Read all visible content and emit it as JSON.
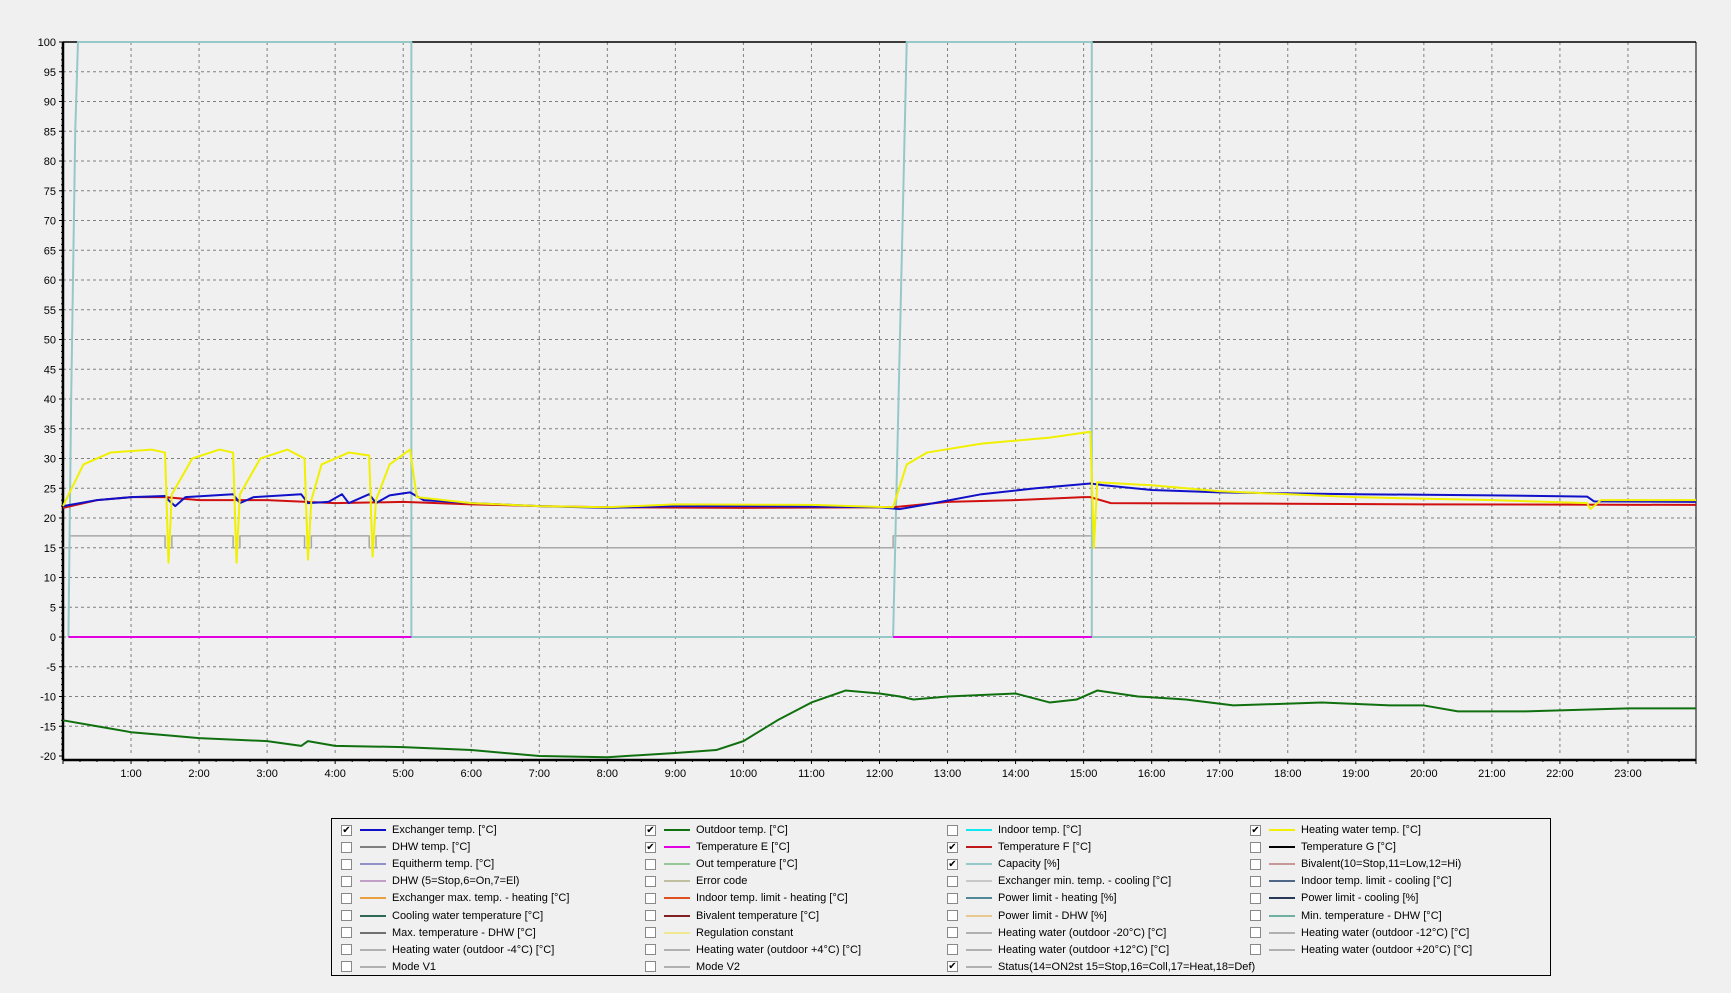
{
  "chart_data": {
    "type": "line",
    "title": "",
    "xlabel": "",
    "ylabel": "",
    "xlim": [
      0,
      24
    ],
    "ylim": [
      -20,
      100
    ],
    "grid": true,
    "x_tick_labels": [
      "1:00",
      "2:00",
      "3:00",
      "4:00",
      "5:00",
      "6:00",
      "7:00",
      "8:00",
      "9:00",
      "10:00",
      "11:00",
      "12:00",
      "13:00",
      "14:00",
      "15:00",
      "16:00",
      "17:00",
      "18:00",
      "19:00",
      "20:00",
      "21:00",
      "22:00",
      "23:00"
    ],
    "y_tick_labels": [
      "100",
      "95",
      "90",
      "85",
      "80",
      "75",
      "70",
      "65",
      "60",
      "55",
      "50",
      "45",
      "40",
      "35",
      "30",
      "25",
      "20",
      "15",
      "10",
      "5",
      "0",
      "-5",
      "-10",
      "-15",
      "-20"
    ],
    "legend_placement": "bottom",
    "series": [
      {
        "name": "Status",
        "color": "#a8a8a8",
        "x": [
          0,
          0.1,
          0.1,
          1.5,
          1.5,
          1.6,
          1.6,
          2.5,
          2.5,
          2.6,
          2.6,
          3.55,
          3.55,
          3.65,
          3.65,
          4.5,
          4.5,
          4.6,
          4.6,
          5.12,
          5.12,
          12.2,
          12.2,
          15.12,
          15.12,
          24
        ],
        "y": [
          15,
          15,
          17,
          17,
          15,
          15,
          17,
          17,
          15,
          15,
          17,
          17,
          15,
          15,
          17,
          17,
          15,
          15,
          17,
          17,
          15,
          15,
          17,
          17,
          15,
          15
        ]
      },
      {
        "name": "Capacity",
        "color": "#96c8c8",
        "x": [
          0.08,
          0.12,
          0.18,
          0.22,
          5.12,
          5.12,
          12.2,
          12.4,
          15.12,
          15.12,
          24
        ],
        "y": [
          0,
          40,
          85,
          100,
          100,
          0,
          0,
          100,
          100,
          0,
          0
        ]
      },
      {
        "name": "Temperature E",
        "color": "#e000e0",
        "x": [
          0.08,
          5.12
        ],
        "y": [
          0,
          0
        ],
        "x2": [
          12.2,
          15.12
        ]
      },
      {
        "name": "Outdoor temp.",
        "color": "#107010",
        "x": [
          0,
          0.5,
          1,
          1.5,
          2,
          3,
          3.5,
          3.6,
          4,
          5,
          6,
          7,
          8,
          9,
          9.6,
          10,
          10.5,
          11,
          11.5,
          12,
          12.3,
          12.5,
          13,
          14,
          14.5,
          14.9,
          15.2,
          15.8,
          16.5,
          17.2,
          18.5,
          19.5,
          20,
          20.5,
          21.5,
          23,
          24
        ],
        "y": [
          -14,
          -15,
          -16,
          -16.5,
          -17,
          -17.5,
          -18.3,
          -17.5,
          -18.3,
          -18.5,
          -19,
          -20,
          -20.2,
          -19.5,
          -19,
          -17.5,
          -14,
          -11,
          -9,
          -9.5,
          -10,
          -10.5,
          -10,
          -9.5,
          -11,
          -10.5,
          -9,
          -10,
          -10.5,
          -11.5,
          -11,
          -11.5,
          -11.5,
          -12.5,
          -12.5,
          -12,
          -12
        ]
      },
      {
        "name": "Temperature F",
        "color": "#d01010",
        "x": [
          0,
          0.5,
          1,
          1.5,
          2,
          3,
          4,
          5,
          6,
          7,
          8,
          10,
          12.2,
          13,
          14,
          15,
          15.1,
          15.4,
          18,
          20,
          24
        ],
        "y": [
          21.7,
          23,
          23.5,
          23.5,
          23,
          23,
          22.5,
          22.7,
          22.3,
          22,
          21.8,
          21.7,
          21.8,
          22.7,
          23,
          23.5,
          23.5,
          22.5,
          22.4,
          22.3,
          22.2
        ]
      },
      {
        "name": "Exchanger temp.",
        "color": "#1010c8",
        "x": [
          0,
          0.5,
          1,
          1.5,
          1.55,
          1.65,
          1.8,
          2.5,
          2.6,
          2.8,
          3.5,
          3.6,
          3.9,
          4.1,
          4.2,
          4.5,
          4.6,
          4.8,
          5.1,
          5.3,
          6,
          7,
          8,
          9,
          10,
          12,
          12.3,
          12.8,
          13.5,
          14.3,
          15.1,
          15.3,
          16,
          17,
          19,
          21,
          22.4,
          22.5,
          24
        ],
        "y": [
          22,
          23,
          23.5,
          23.7,
          23,
          22,
          23.5,
          24,
          22.5,
          23.5,
          24,
          22.5,
          22.7,
          24,
          22.5,
          24,
          22.5,
          23.8,
          24.3,
          23,
          22.5,
          22,
          21.7,
          22,
          22,
          21.8,
          21.5,
          22.5,
          24,
          25,
          25.8,
          25.5,
          24.7,
          24.3,
          24,
          23.8,
          23.6,
          22.8,
          22.7
        ]
      },
      {
        "name": "Heating water temp.",
        "color": "#f0f000",
        "x": [
          0,
          0.3,
          0.7,
          1.3,
          1.5,
          1.55,
          1.6,
          1.9,
          2.3,
          2.5,
          2.55,
          2.6,
          2.9,
          3.3,
          3.55,
          3.6,
          3.65,
          3.8,
          4.2,
          4.5,
          4.55,
          4.6,
          4.8,
          5.1,
          5.2,
          6,
          7,
          8,
          9,
          11,
          12.2,
          12.4,
          12.7,
          13.5,
          14.5,
          15.1,
          15.15,
          15.2,
          16,
          17,
          19,
          21,
          22.4,
          22.45,
          22.6,
          24
        ],
        "y": [
          22,
          29,
          31,
          31.5,
          31,
          12.5,
          24,
          30,
          31.5,
          31,
          12.5,
          24,
          30,
          31.5,
          30,
          13,
          23,
          29,
          31,
          30.5,
          13.5,
          23,
          29,
          31.5,
          23.5,
          22.5,
          22,
          21.8,
          22.3,
          22.2,
          21.8,
          29,
          31,
          32.5,
          33.5,
          34.5,
          15,
          26,
          25.5,
          24.5,
          23.5,
          23,
          22.5,
          21.5,
          23,
          23
        ]
      }
    ]
  },
  "legend": {
    "items": [
      {
        "label": "Exchanger temp. [°C]",
        "color": "#1010c8",
        "checked": true
      },
      {
        "label": "DHW temp. [°C]",
        "color": "#808080",
        "checked": false
      },
      {
        "label": "Equitherm temp. [°C]",
        "color": "#9090c8",
        "checked": false
      },
      {
        "label": "DHW (5=Stop,6=On,7=El)",
        "color": "#c0a0c8",
        "checked": false
      },
      {
        "label": "Exchanger max. temp. - heating [°C]",
        "color": "#e8a040",
        "checked": false
      },
      {
        "label": "Cooling water temperature [°C]",
        "color": "#306858",
        "checked": false
      },
      {
        "label": "Max. temperature - DHW [°C]",
        "color": "#707070",
        "checked": false
      },
      {
        "label": "Heating water (outdoor -4°C) [°C]",
        "color": "#b0b0b0",
        "checked": false
      },
      {
        "label": "Mode V1",
        "color": "#b0b0b0",
        "checked": false
      },
      {
        "label": "Outdoor temp. [°C]",
        "color": "#107010",
        "checked": true
      },
      {
        "label": "Temperature E [°C]",
        "color": "#e000e0",
        "checked": true
      },
      {
        "label": "Out temperature [°C]",
        "color": "#98c898",
        "checked": false
      },
      {
        "label": "Error code",
        "color": "#c0c0a0",
        "checked": false
      },
      {
        "label": "Indoor temp. limit - heating [°C]",
        "color": "#e05020",
        "checked": false
      },
      {
        "label": "Bivalent temperature [°C]",
        "color": "#802020",
        "checked": false
      },
      {
        "label": "Regulation constant",
        "color": "#f0e890",
        "checked": false
      },
      {
        "label": "Heating water (outdoor +4°C) [°C]",
        "color": "#b0b0b0",
        "checked": false
      },
      {
        "label": "Mode V2",
        "color": "#b0b0b0",
        "checked": false
      },
      {
        "label": "Indoor temp. [°C]",
        "color": "#10e8f0",
        "checked": false
      },
      {
        "label": "Temperature F [°C]",
        "color": "#c01818",
        "checked": true
      },
      {
        "label": "Capacity [%]",
        "color": "#96c8c8",
        "checked": true
      },
      {
        "label": "Exchanger min. temp. - cooling [°C]",
        "color": "#c8c8c8",
        "checked": false
      },
      {
        "label": "Power limit - heating [%]",
        "color": "#508898",
        "checked": false
      },
      {
        "label": "Power limit - DHW [%]",
        "color": "#e8c890",
        "checked": false
      },
      {
        "label": "Heating water (outdoor -20°C) [°C]",
        "color": "#b0b0b0",
        "checked": false
      },
      {
        "label": "Heating water (outdoor +12°C) [°C]",
        "color": "#b0b0b0",
        "checked": false
      },
      {
        "label": "Status(14=ON2st 15=Stop,16=Coll,17=Heat,18=Def)",
        "color": "#b0b0b0",
        "checked": true
      },
      {
        "label": "Heating water temp. [°C]",
        "color": "#f0f000",
        "checked": true
      },
      {
        "label": "Temperature G [°C]",
        "color": "#000000",
        "checked": false
      },
      {
        "label": "Bivalent(10=Stop,11=Low,12=Hi)",
        "color": "#c89898",
        "checked": false
      },
      {
        "label": "Indoor temp. limit - cooling [°C]",
        "color": "#506888",
        "checked": false
      },
      {
        "label": "Power limit - cooling [%]",
        "color": "#283858",
        "checked": false
      },
      {
        "label": "Min. temperature - DHW [°C]",
        "color": "#70b0a0",
        "checked": false
      },
      {
        "label": "Heating water (outdoor -12°C) [°C]",
        "color": "#b0b0b0",
        "checked": false
      },
      {
        "label": "Heating water (outdoor +20°C) [°C]",
        "color": "#b0b0b0",
        "checked": false
      }
    ]
  }
}
